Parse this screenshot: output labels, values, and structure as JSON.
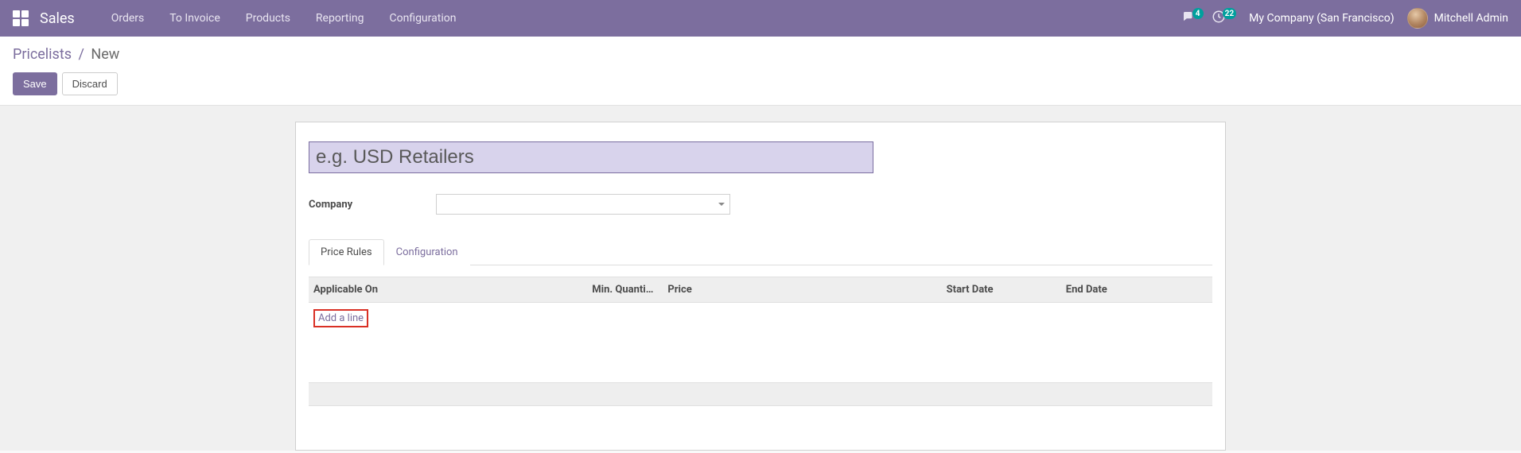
{
  "navbar": {
    "app_title": "Sales",
    "menu": [
      "Orders",
      "To Invoice",
      "Products",
      "Reporting",
      "Configuration"
    ],
    "messages_badge": "4",
    "activities_badge": "22",
    "company": "My Company (San Francisco)",
    "user": "Mitchell Admin"
  },
  "breadcrumb": {
    "parent": "Pricelists",
    "separator": "/",
    "current": "New"
  },
  "buttons": {
    "save": "Save",
    "discard": "Discard"
  },
  "form": {
    "name_placeholder": "e.g. USD Retailers",
    "name_value": "",
    "company_label": "Company",
    "company_value": ""
  },
  "tabs": {
    "price_rules": "Price Rules",
    "configuration": "Configuration",
    "active": "price_rules"
  },
  "table": {
    "headers": {
      "applicable_on": "Applicable On",
      "min_quantity": "Min. Quanti…",
      "price": "Price",
      "start_date": "Start Date",
      "end_date": "End Date"
    },
    "add_line": "Add a line",
    "rows": []
  }
}
